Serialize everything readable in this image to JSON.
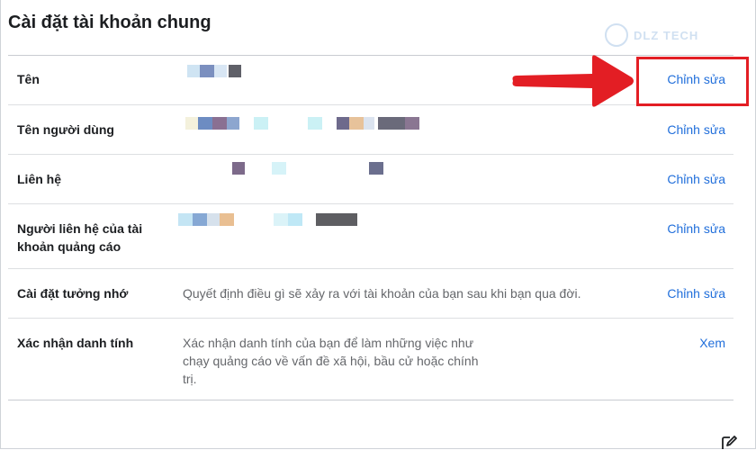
{
  "page": {
    "title": "Cài đặt tài khoản chung"
  },
  "watermark": {
    "text": "DLZ TECH"
  },
  "rows": [
    {
      "label": "Tên",
      "description": "",
      "action": "Chỉnh sửa"
    },
    {
      "label": "Tên người dùng",
      "description": "",
      "action": "Chỉnh sửa"
    },
    {
      "label": "Liên hệ",
      "description": "",
      "action": "Chỉnh sửa"
    },
    {
      "label": "Người liên hệ của tài khoản quảng cáo",
      "description": "",
      "action": "Chỉnh sửa"
    },
    {
      "label": "Cài đặt tưởng nhớ",
      "description": "Quyết định điều gì sẽ xảy ra với tài khoản của bạn sau khi bạn qua đời.",
      "action": "Chỉnh sửa"
    },
    {
      "label": "Xác nhận danh tính",
      "description": "Xác nhận danh tính của bạn để làm những việc như chạy quảng cáo về vấn đề xã hội, bầu cử hoặc chính trị.",
      "action": "Xem"
    }
  ],
  "colors": {
    "link": "#216fdb",
    "annotation": "#e31e24"
  }
}
